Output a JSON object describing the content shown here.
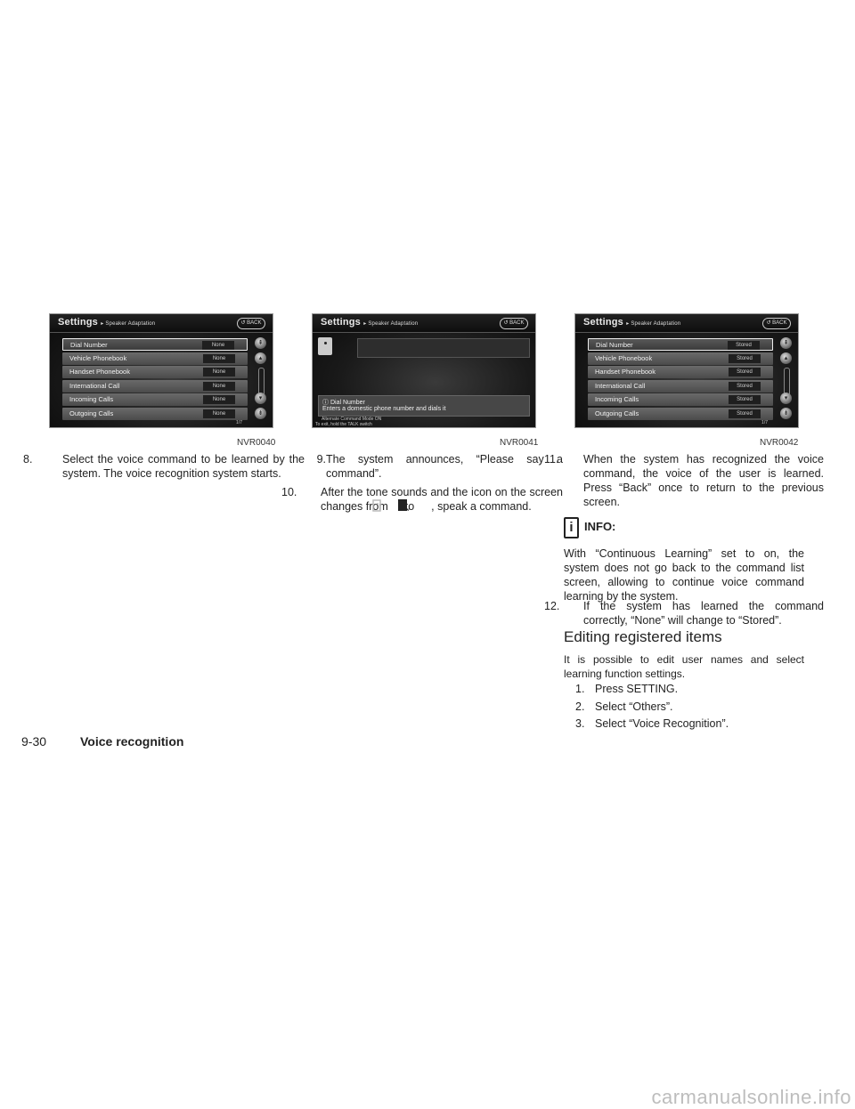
{
  "screens": [
    {
      "title": "Settings",
      "subtitle": "Speaker Adaptation",
      "back_label": "BACK",
      "items": [
        {
          "label": "Dial Number",
          "value": "None",
          "selected": true
        },
        {
          "label": "Vehicle Phonebook",
          "value": "None"
        },
        {
          "label": "Handset Phonebook",
          "value": "None"
        },
        {
          "label": "International Call",
          "value": "None"
        },
        {
          "label": "Incoming Calls",
          "value": "None"
        },
        {
          "label": "Outgoing Calls",
          "value": "None"
        }
      ],
      "page_indicator": "1/7",
      "figure_id": "NVR0040"
    },
    {
      "title": "Settings",
      "subtitle": "Speaker Adaptation",
      "back_label": "BACK",
      "info_title": "Dial Number",
      "info_desc": "Enters a domestic phone number and dials it",
      "alt_mode": "Alternate Command Mode ON",
      "exit_hint": "To exit, hold the TALK switch",
      "figure_id": "NVR0041"
    },
    {
      "title": "Settings",
      "subtitle": "Speaker Adaptation",
      "back_label": "BACK",
      "items": [
        {
          "label": "Dial Number",
          "value": "Stored",
          "selected": true
        },
        {
          "label": "Vehicle Phonebook",
          "value": "Stored"
        },
        {
          "label": "Handset Phonebook",
          "value": "Stored"
        },
        {
          "label": "International Call",
          "value": "Stored"
        },
        {
          "label": "Incoming Calls",
          "value": "Stored"
        },
        {
          "label": "Outgoing Calls",
          "value": "Stored"
        }
      ],
      "page_indicator": "1/7",
      "figure_id": "NVR0042"
    }
  ],
  "steps": {
    "s8": {
      "num": "8.",
      "text": "Select the voice command to be learned by the system. The voice recognition system starts."
    },
    "s9": {
      "num": "9.",
      "text": "The system announces, “Please say a command”."
    },
    "s10": {
      "num": "10.",
      "text_a": "After the tone sounds and the icon on the screen changes from",
      "text_b": "to",
      "text_c": ", speak a command."
    },
    "s11": {
      "num": "11.",
      "text": "When the system has recognized the voice command, the voice of the user is learned. Press “Back” once to return to the previous screen."
    },
    "info_label": "INFO:",
    "info_text": "With “Continuous Learning” set to on, the system does not go back to the command list screen, allowing to continue voice command learning by the system.",
    "s12": {
      "num": "12.",
      "text": "If the system has learned the command correctly, “None” will change to “Stored”."
    }
  },
  "section": {
    "heading": "Editing registered items",
    "intro": "It is possible to edit user names and select learning function settings.",
    "items": [
      {
        "num": "1.",
        "text": "Press SETTING."
      },
      {
        "num": "2.",
        "text": "Select “Others”."
      },
      {
        "num": "3.",
        "text": "Select “Voice Recognition”."
      }
    ]
  },
  "footer": {
    "page": "9-30",
    "title": "Voice recognition"
  },
  "watermark": "carmanualsonline.info"
}
